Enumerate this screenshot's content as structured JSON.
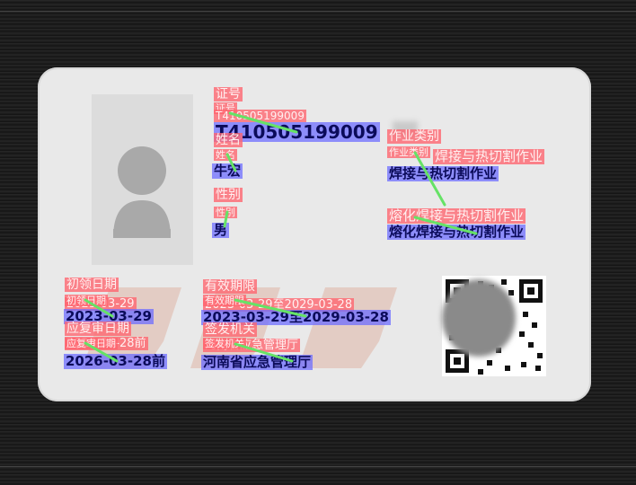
{
  "card": {
    "id_label": "证号",
    "id_label_sm": "证号",
    "id_faint": "T410505199009",
    "id_value": "T410505199009",
    "name_label": "姓名",
    "name_label_sm": "姓名",
    "name_value": "牛宏",
    "gender_label": "性别",
    "gender_label_sm": "性别",
    "gender_value": "男",
    "job_label": "作业类别",
    "job_label_sm": "作业类别",
    "job_value": "焊接与热切割作业",
    "job_faint": "焊接与热切割作业",
    "project_faint": "熔化焊接与热切割作业",
    "project_value": "熔化焊接与热切割作业",
    "first_label": "初领日期",
    "first_label_sm": "初领日期",
    "first_faint": "2023-03-29",
    "first_value": "2023-03-29",
    "valid_label": "有效期限",
    "valid_label_sm": "有效期限",
    "valid_faint": "2023-03-29至2029-03-28",
    "valid_value": "2023-03-29至2029-03-28",
    "review_label": "应复审日期",
    "review_label_sm": "应复审日期",
    "review_faint": "2026-03-28前",
    "review_value": "2026-03-28前",
    "issuer_label": "签发机关",
    "issuer_label_sm": "签发机关",
    "issuer_faint": "河南省应急管理厅",
    "issuer_value": "河南省应急管理厅"
  },
  "colors": {
    "label_box": "#ff6470",
    "value_box": "#6e6eff",
    "link_line": "#66e266",
    "card": "#e9e9e9"
  },
  "icons": {
    "photo": "person-silhouette-icon",
    "qr": "qr-code-icon"
  }
}
